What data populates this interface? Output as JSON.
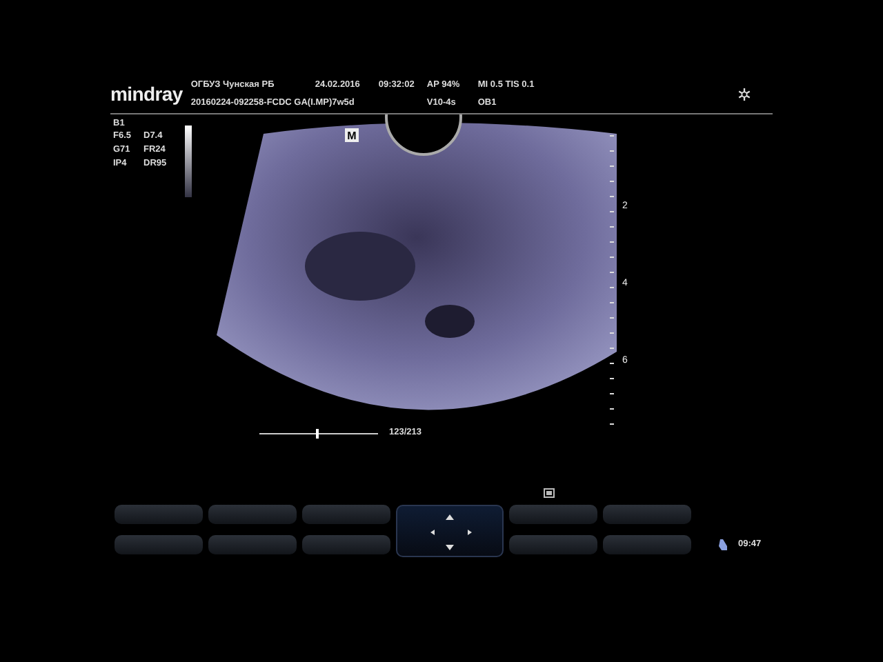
{
  "header": {
    "logo": "mindray",
    "line_1": [
      "ОГБУЗ Чунская РБ",
      "24.02.2016",
      "09:32:02",
      "AP  94%",
      "MI 0.5 TIS 0.1"
    ],
    "line_2": [
      "20160224-092258-FCDC GA(I.MP)7w5d",
      "V10-4s",
      "OB1"
    ]
  },
  "mode": "B1",
  "params": [
    [
      "F6.5",
      "D7.4"
    ],
    [
      "G71",
      "FR24"
    ],
    [
      "IP4",
      "DR95"
    ]
  ],
  "image": {
    "orientation_mark": "M",
    "depth_labels": [
      "2",
      "4",
      "6"
    ]
  },
  "cine": {
    "frame": "123/213",
    "level": 0.48
  },
  "clock": "09:47"
}
